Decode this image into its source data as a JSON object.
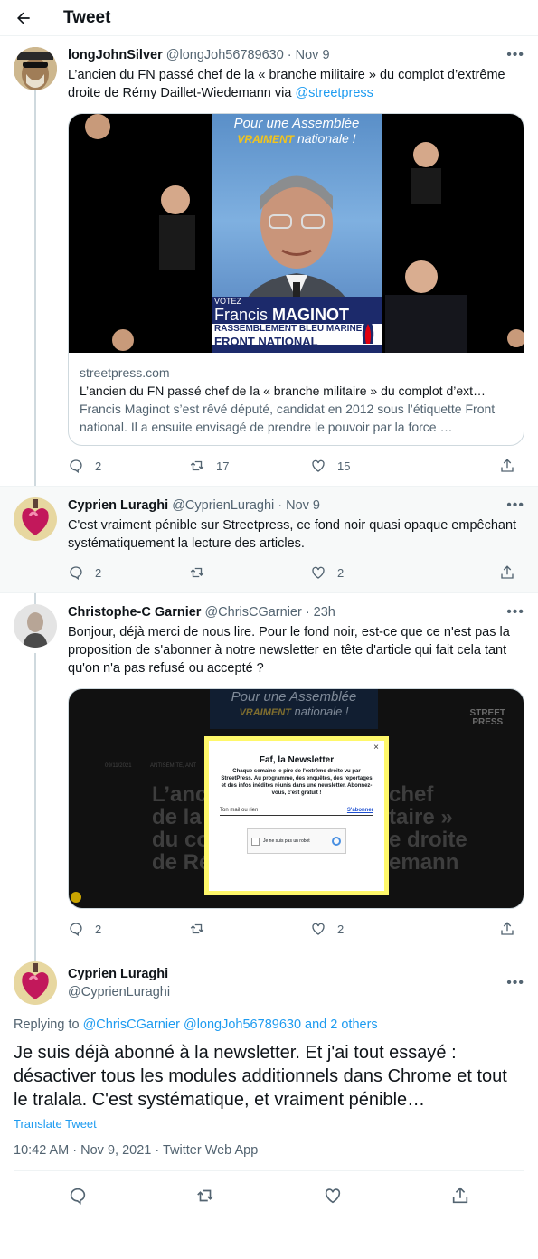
{
  "header": {
    "title": "Tweet"
  },
  "tweets": [
    {
      "name": "longJohnSilver",
      "handle": "@longJoh56789630",
      "dot": "·",
      "time": "Nov 9",
      "text": "L’ancien du FN passé chef de la « branche militaire » du complot d’extrême droite de Rémy Daillet-Wiedemann via ",
      "mention": "@streetpress",
      "card": {
        "domain": "streetpress.com",
        "title": "L’ancien du FN passé chef de la « branche militaire » du complot d’ext…",
        "description": "Francis Maginot s’est rêvé député, candidat en 2012 sous l’étiquette Front national. Il a ensuite envisagé de prendre le pouvoir par la force …",
        "poster_line1": "Pour une Assemblée",
        "poster_line2a": "VRAIMENT",
        "poster_line2b": "nationale !",
        "votez": "VOTEZ",
        "candidate_first": "Francis",
        "candidate_last": "MAGINOT",
        "party1": "RASSEMBLEMENT BLEU MARINE",
        "party2": "FRONT NATIONAL"
      },
      "replies": "2",
      "retweets": "17",
      "likes": "15"
    },
    {
      "name": "Cyprien Luraghi",
      "handle": "@CyprienLuraghi",
      "dot": "·",
      "time": "Nov 9",
      "text": "C'est vraiment pénible sur Streetpress, ce fond noir quasi opaque empêchant systématiquement la lecture des articles.",
      "replies": "2",
      "retweets": "",
      "likes": "2"
    },
    {
      "name": "Christophe-C Garnier",
      "handle": "@ChrisCGarnier",
      "dot": "·",
      "time": "23h",
      "text": "Bonjour, déjà merci de nous lire. Pour le fond noir, est-ce que ce n'est pas la proposition de s'abonner à notre newsletter en tête d'article qui fait cela tant qu'on n'a pas refusé ou accepté ?",
      "photo": {
        "bg_line1": "Pour une Assemblée",
        "bg_line2a": "VRAIMENT",
        "bg_line2b": "nationale !",
        "logo1": "STREET",
        "logo2": "PRESS",
        "date": "09/11/2021",
        "tag": "ANTISÉMITE, ANT",
        "headline1": "L’ancien",
        "headline1b": "chef",
        "headline2": "de la",
        "headline2b": "taire »",
        "headline3": "du co",
        "headline3b": "e droite",
        "headline4": "de Ré",
        "headline4b": "emann",
        "modal_title": "Faf, la Newsletter",
        "modal_text": "Chaque semaine le pire de l'extrême droite vu par StreetPress. Au programme, des enquêtes, des reportages et des infos inédites réunis dans une newsletter. Abonnez-vous, c'est gratuit !",
        "modal_placeholder": "Ton mail ou rien",
        "modal_button": "S'abonner",
        "captcha": "Je ne suis pas un robot",
        "close": "×"
      },
      "replies": "2",
      "retweets": "",
      "likes": "2"
    }
  ],
  "main": {
    "name": "Cyprien Luraghi",
    "handle": "@CyprienLuraghi",
    "reply_prefix": "Replying to ",
    "reply_mentions": "@ChrisCGarnier @longJoh56789630 and 2 others",
    "text": "Je suis déjà abonné à la newsletter. Et j'ai tout essayé : désactiver tous les modules additionnels dans Chrome et tout le tralala. C'est systématique, et vraiment pénible…",
    "translate": "Translate Tweet",
    "meta": "10:42 AM · Nov 9, 2021 · Twitter Web App"
  },
  "colors": {
    "accent": "#1d9bf0",
    "muted": "#536471",
    "navy": "#1c2a6b"
  }
}
